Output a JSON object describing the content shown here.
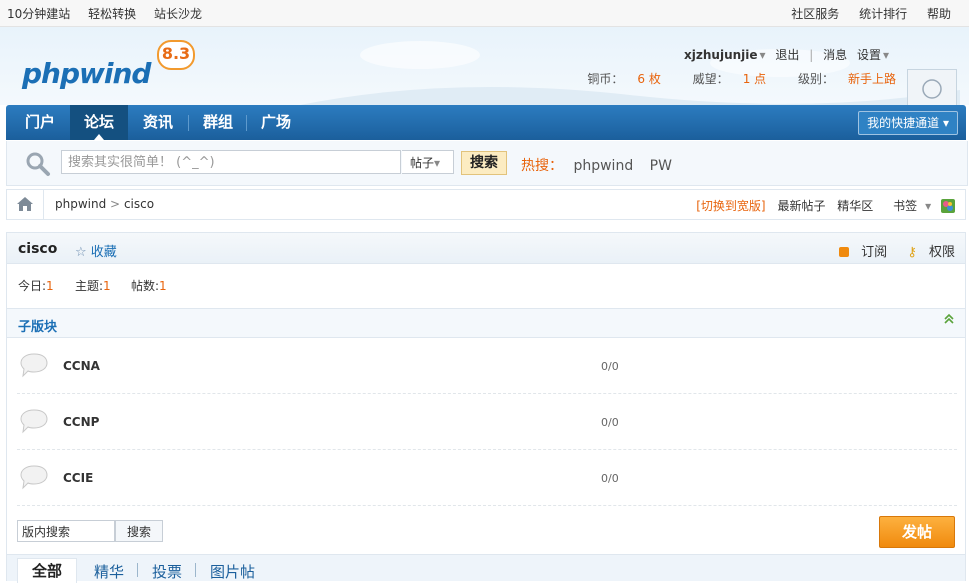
{
  "topbar": {
    "left": [
      "10分钟建站",
      "轻松转换",
      "站长沙龙"
    ],
    "right": [
      "社区服务",
      "统计排行",
      "帮助"
    ]
  },
  "logo": {
    "text": "phpwind",
    "version": "8.3"
  },
  "user": {
    "name": "xjzhujunjie",
    "logout": "退出",
    "messages": "消息",
    "settings": "设置",
    "coin_label": "铜币：",
    "coin_value": "6 枚",
    "rep_label": "威望：",
    "rep_value": "1 点",
    "level_label": "级别：",
    "level_value": "新手上路"
  },
  "nav": {
    "items": [
      "门户",
      "论坛",
      "资讯",
      "群组",
      "广场"
    ],
    "active": "论坛",
    "quick": "我的快捷通道"
  },
  "search": {
    "placeholder": "搜索其实很简单！ (^_^)",
    "type": "帖子",
    "button": "搜索",
    "hot_label": "热搜：",
    "hot_words": [
      "phpwind",
      "PW"
    ]
  },
  "breadcrumb": {
    "root": "phpwind",
    "sep": ">",
    "current": "cisco",
    "wide": "[切换到宽版]",
    "newest": "最新帖子",
    "digest": "精华区",
    "bookmark": "书签"
  },
  "forum": {
    "name": "cisco",
    "favorite": "收藏",
    "subscribe": "订阅",
    "permission": "权限",
    "today_label": "今日:",
    "today": "1",
    "topics_label": "主题:",
    "topics": "1",
    "posts_label": "帖数:",
    "posts": "1"
  },
  "subforums": {
    "title": "子版块",
    "items": [
      {
        "name": "CCNA",
        "count": "0/0"
      },
      {
        "name": "CCNP",
        "count": "0/0"
      },
      {
        "name": "CCIE",
        "count": "0/0"
      }
    ]
  },
  "bottom": {
    "forum_search_value": "版内搜索",
    "forum_search_button": "搜索",
    "post_button": "发帖"
  },
  "tabs": [
    "全部",
    "精华",
    "投票",
    "图片帖"
  ]
}
